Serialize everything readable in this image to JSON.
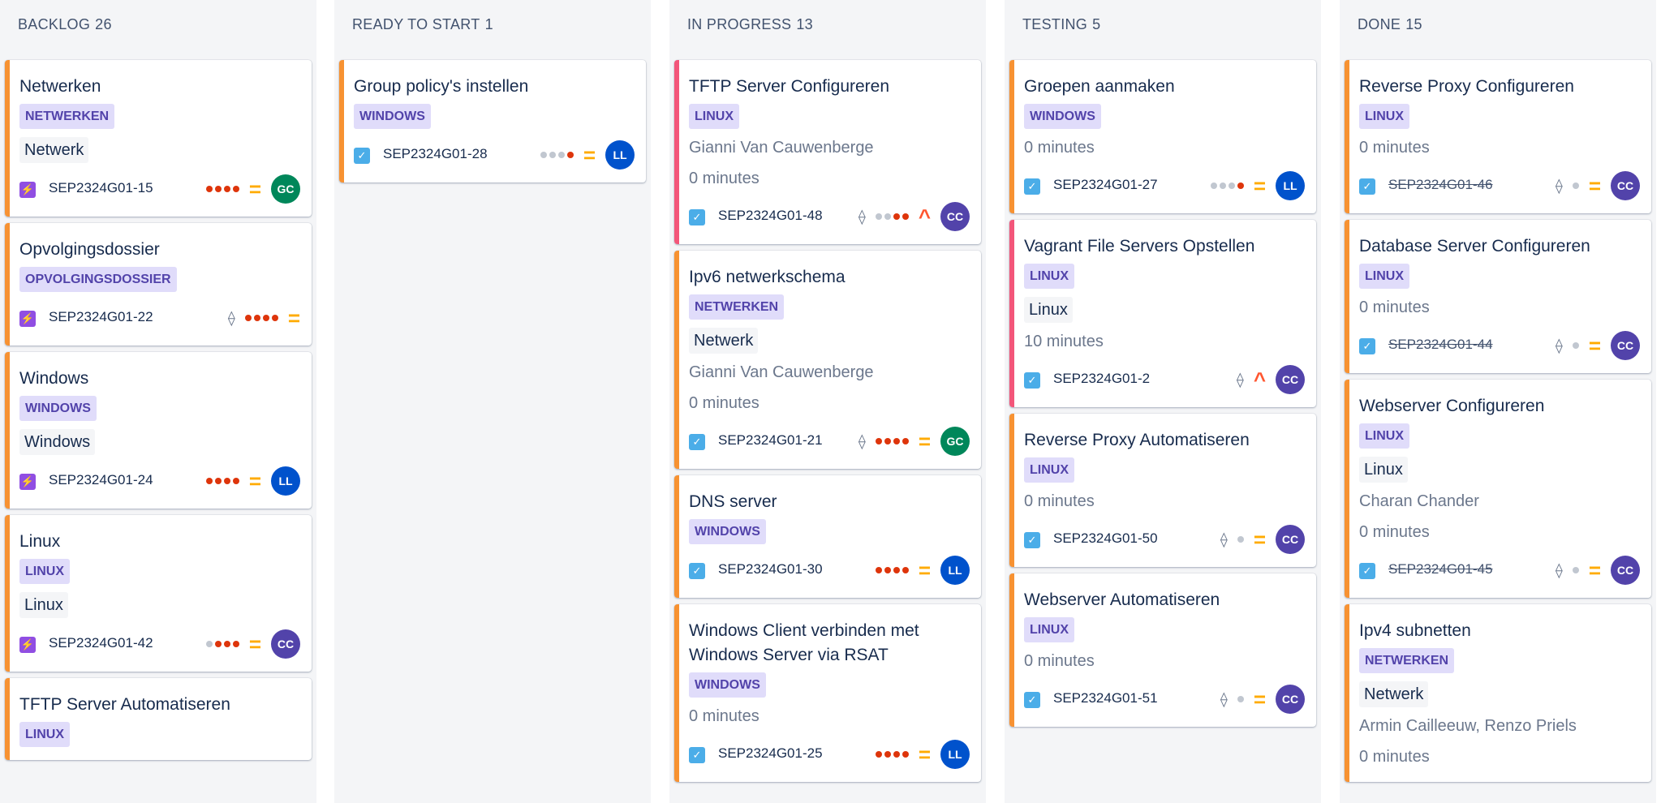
{
  "colors": {
    "edge_medium": "#f79232",
    "edge_high": "#f3567a",
    "avatar_GC": "#00875a",
    "avatar_LL": "#0052cc",
    "avatar_CC": "#5243aa"
  },
  "columns": [
    {
      "title": "BACKLOG",
      "count": "26",
      "cards": [
        {
          "title": "Netwerken",
          "label": "NETWERKEN",
          "tag": "Netwerk",
          "lines": [],
          "type": "epic",
          "key": "SEP2324G01-15",
          "done": false,
          "branch": false,
          "dots": [
            "red",
            "red",
            "red",
            "red"
          ],
          "priority": "medium",
          "priority_icon": "=",
          "assignee": "GC",
          "edge": "medium"
        },
        {
          "title": "Opvolgingsdossier",
          "label": "OPVOLGINGSDOSSIER",
          "tag": "",
          "lines": [],
          "type": "epic",
          "key": "SEP2324G01-22",
          "done": false,
          "branch": true,
          "dots": [
            "red",
            "red",
            "red",
            "red"
          ],
          "priority": "medium",
          "priority_icon": "=",
          "assignee": "",
          "edge": "medium"
        },
        {
          "title": "Windows",
          "label": "WINDOWS",
          "tag": "Windows",
          "lines": [],
          "type": "epic",
          "key": "SEP2324G01-24",
          "done": false,
          "branch": false,
          "dots": [
            "red",
            "red",
            "red",
            "red"
          ],
          "priority": "medium",
          "priority_icon": "=",
          "assignee": "LL",
          "edge": "medium"
        },
        {
          "title": "Linux",
          "label": "LINUX",
          "tag": "Linux",
          "lines": [],
          "type": "epic",
          "key": "SEP2324G01-42",
          "done": false,
          "branch": false,
          "dots": [
            "grey",
            "red",
            "red",
            "red"
          ],
          "priority": "medium",
          "priority_icon": "=",
          "assignee": "CC",
          "edge": "medium"
        },
        {
          "title": "TFTP Server Automatiseren",
          "label": "LINUX",
          "tag": "",
          "lines": [],
          "type": "story",
          "key": "",
          "done": false,
          "branch": false,
          "dots": [],
          "priority": "",
          "priority_icon": "",
          "assignee": "",
          "edge": "medium"
        }
      ]
    },
    {
      "title": "READY TO START",
      "count": "1",
      "cards": [
        {
          "title": "Group policy's instellen",
          "label": "WINDOWS",
          "tag": "",
          "lines": [],
          "type": "story",
          "key": "SEP2324G01-28",
          "done": false,
          "branch": false,
          "dots": [
            "grey",
            "grey",
            "grey",
            "red"
          ],
          "priority": "medium",
          "priority_icon": "=",
          "assignee": "LL",
          "edge": "medium"
        }
      ]
    },
    {
      "title": "IN PROGRESS",
      "count": "13",
      "cards": [
        {
          "title": "TFTP Server Configureren",
          "label": "LINUX",
          "tag": "",
          "lines": [
            "Gianni Van Cauwenberge",
            "0 minutes"
          ],
          "type": "story",
          "key": "SEP2324G01-48",
          "done": false,
          "branch": true,
          "dots": [
            "grey",
            "grey",
            "red",
            "red"
          ],
          "priority": "high",
          "priority_icon": "^",
          "assignee": "CC",
          "edge": "high"
        },
        {
          "title": "Ipv6 netwerkschema",
          "label": "NETWERKEN",
          "tag": "Netwerk",
          "lines": [
            "Gianni Van Cauwenberge",
            "0 minutes"
          ],
          "type": "story",
          "key": "SEP2324G01-21",
          "done": false,
          "branch": true,
          "dots": [
            "red",
            "red",
            "red",
            "red"
          ],
          "priority": "medium",
          "priority_icon": "=",
          "assignee": "GC",
          "edge": "medium"
        },
        {
          "title": "DNS server",
          "label": "WINDOWS",
          "tag": "",
          "lines": [],
          "type": "story",
          "key": "SEP2324G01-30",
          "done": false,
          "branch": false,
          "dots": [
            "red",
            "red",
            "red",
            "red"
          ],
          "priority": "medium",
          "priority_icon": "=",
          "assignee": "LL",
          "edge": "medium"
        },
        {
          "title": "Windows Client verbinden met Windows Server via RSAT",
          "label": "WINDOWS",
          "tag": "",
          "lines": [
            "0 minutes"
          ],
          "type": "story",
          "key": "SEP2324G01-25",
          "done": false,
          "branch": false,
          "dots": [
            "red",
            "red",
            "red",
            "red"
          ],
          "priority": "medium",
          "priority_icon": "=",
          "assignee": "LL",
          "edge": "medium"
        }
      ]
    },
    {
      "title": "TESTING",
      "count": "5",
      "cards": [
        {
          "title": "Groepen aanmaken",
          "label": "WINDOWS",
          "tag": "",
          "lines": [
            "0 minutes"
          ],
          "type": "story",
          "key": "SEP2324G01-27",
          "done": false,
          "branch": false,
          "dots": [
            "grey",
            "grey",
            "grey",
            "red"
          ],
          "priority": "medium",
          "priority_icon": "=",
          "assignee": "LL",
          "edge": "medium"
        },
        {
          "title": "Vagrant File Servers Opstellen",
          "label": "LINUX",
          "tag": "Linux",
          "lines": [
            "10 minutes"
          ],
          "type": "story",
          "key": "SEP2324G01-2",
          "done": false,
          "branch": true,
          "dots": [],
          "priority": "high",
          "priority_icon": "^",
          "assignee": "CC",
          "edge": "high"
        },
        {
          "title": "Reverse Proxy Automatiseren",
          "label": "LINUX",
          "tag": "",
          "lines": [
            "0 minutes"
          ],
          "type": "story",
          "key": "SEP2324G01-50",
          "done": false,
          "branch": true,
          "dots": [
            "grey"
          ],
          "priority": "medium",
          "priority_icon": "=",
          "assignee": "CC",
          "edge": "medium"
        },
        {
          "title": "Webserver Automatiseren",
          "label": "LINUX",
          "tag": "",
          "lines": [
            "0 minutes"
          ],
          "type": "story",
          "key": "SEP2324G01-51",
          "done": false,
          "branch": true,
          "dots": [
            "grey"
          ],
          "priority": "medium",
          "priority_icon": "=",
          "assignee": "CC",
          "edge": "medium"
        }
      ]
    },
    {
      "title": "DONE",
      "count": "15",
      "cards": [
        {
          "title": "Reverse Proxy Configureren",
          "label": "LINUX",
          "tag": "",
          "lines": [
            "0 minutes"
          ],
          "type": "story",
          "key": "SEP2324G01-46",
          "done": true,
          "branch": true,
          "dots": [
            "grey"
          ],
          "priority": "medium",
          "priority_icon": "=",
          "assignee": "CC",
          "edge": "medium"
        },
        {
          "title": "Database Server Configureren",
          "label": "LINUX",
          "tag": "",
          "lines": [
            "0 minutes"
          ],
          "type": "story",
          "key": "SEP2324G01-44",
          "done": true,
          "branch": true,
          "dots": [
            "grey"
          ],
          "priority": "medium",
          "priority_icon": "=",
          "assignee": "CC",
          "edge": "medium"
        },
        {
          "title": "Webserver Configureren",
          "label": "LINUX",
          "tag": "Linux",
          "lines": [
            "Charan Chander",
            "0 minutes"
          ],
          "type": "story",
          "key": "SEP2324G01-45",
          "done": true,
          "branch": true,
          "dots": [
            "grey"
          ],
          "priority": "medium",
          "priority_icon": "=",
          "assignee": "CC",
          "edge": "medium"
        },
        {
          "title": "Ipv4 subnetten",
          "label": "NETWERKEN",
          "tag": "Netwerk",
          "lines": [
            "Armin Cailleeuw, Renzo Priels",
            "0 minutes"
          ],
          "type": "story",
          "key": "",
          "done": false,
          "branch": false,
          "dots": [],
          "priority": "",
          "priority_icon": "",
          "assignee": "",
          "edge": "medium"
        }
      ]
    }
  ]
}
